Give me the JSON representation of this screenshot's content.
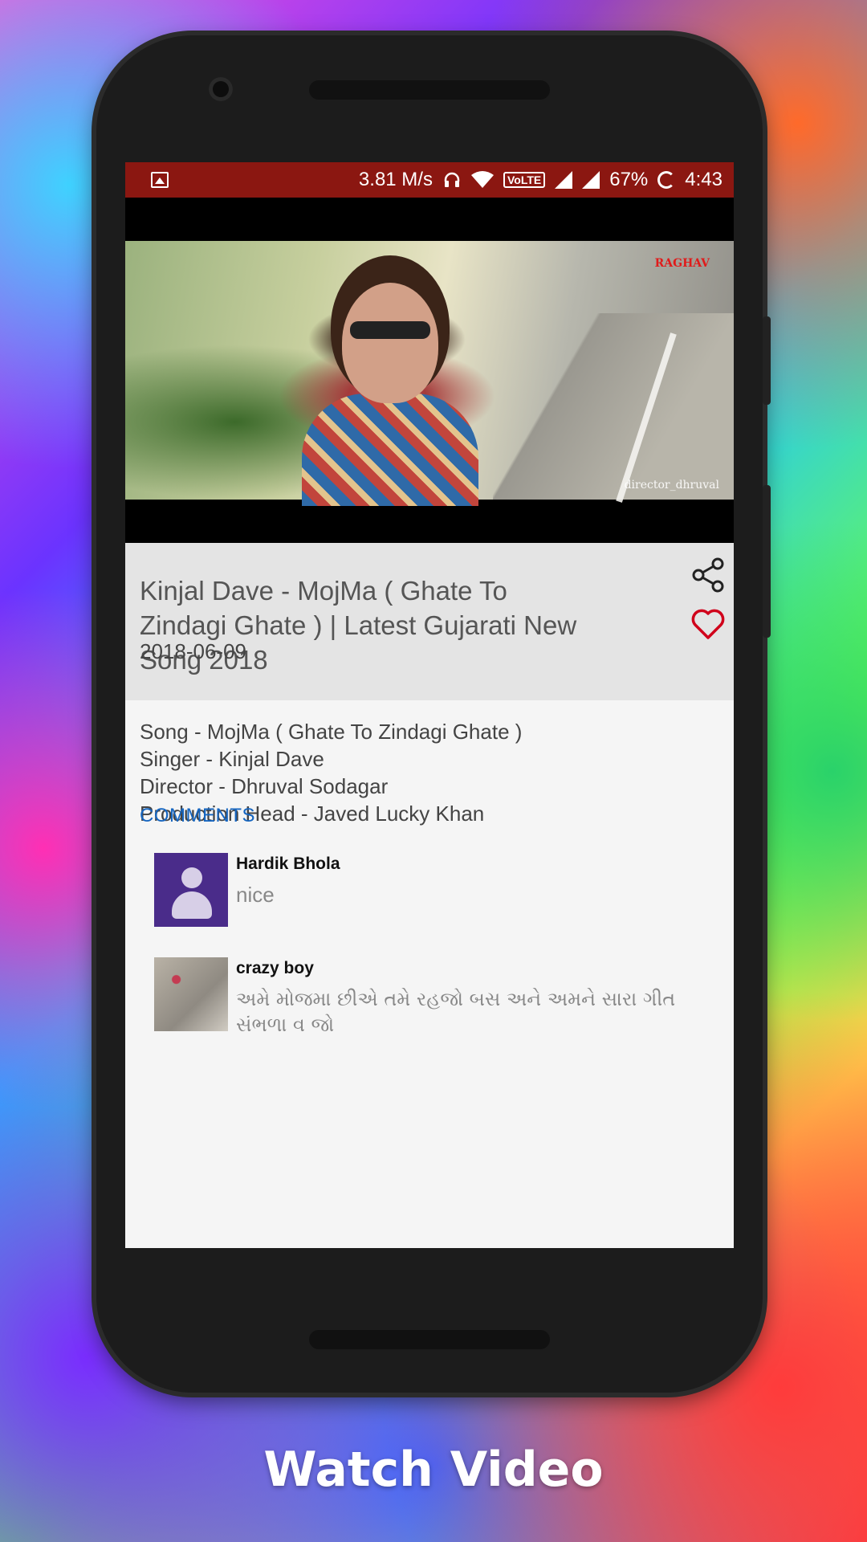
{
  "status_bar": {
    "speed": "3.81 M/s",
    "volte_label": "VoLTE",
    "battery": "67%",
    "time": "4:43",
    "icons": [
      "image-icon",
      "headphones-icon",
      "wifi-icon",
      "volte-icon",
      "signal-icon",
      "signal-icon",
      "battery-icon"
    ]
  },
  "video": {
    "watermark_logo": "RAGHAV",
    "watermark_text": "director_dhruval",
    "title": "Kinjal Dave - MojMa ( Ghate To Zindagi Ghate ) | Latest Gujarati New Song 2018",
    "date": "2018-06-09"
  },
  "description": {
    "lines": [
      "Song - MojMa ( Ghate To Zindagi Ghate )",
      "Singer - Kinjal Dave",
      "Director - Dhruval Sodagar",
      "Production Head - Javed Lucky Khan"
    ]
  },
  "comments": {
    "header": "COMMENTS",
    "items": [
      {
        "name": "Hardik Bhola",
        "text": "nice"
      },
      {
        "name": "crazy boy",
        "text": "અમે મોજમા છીએ તમે રહજો બસ અને અમને સારા ગીત સંભળા વ જો"
      }
    ]
  },
  "caption": "Watch Video",
  "colors": {
    "status_bar": "#8b1711",
    "title_block": "#e4e4e4",
    "comments_header": "#1565c0",
    "heart": "#d0021b"
  }
}
